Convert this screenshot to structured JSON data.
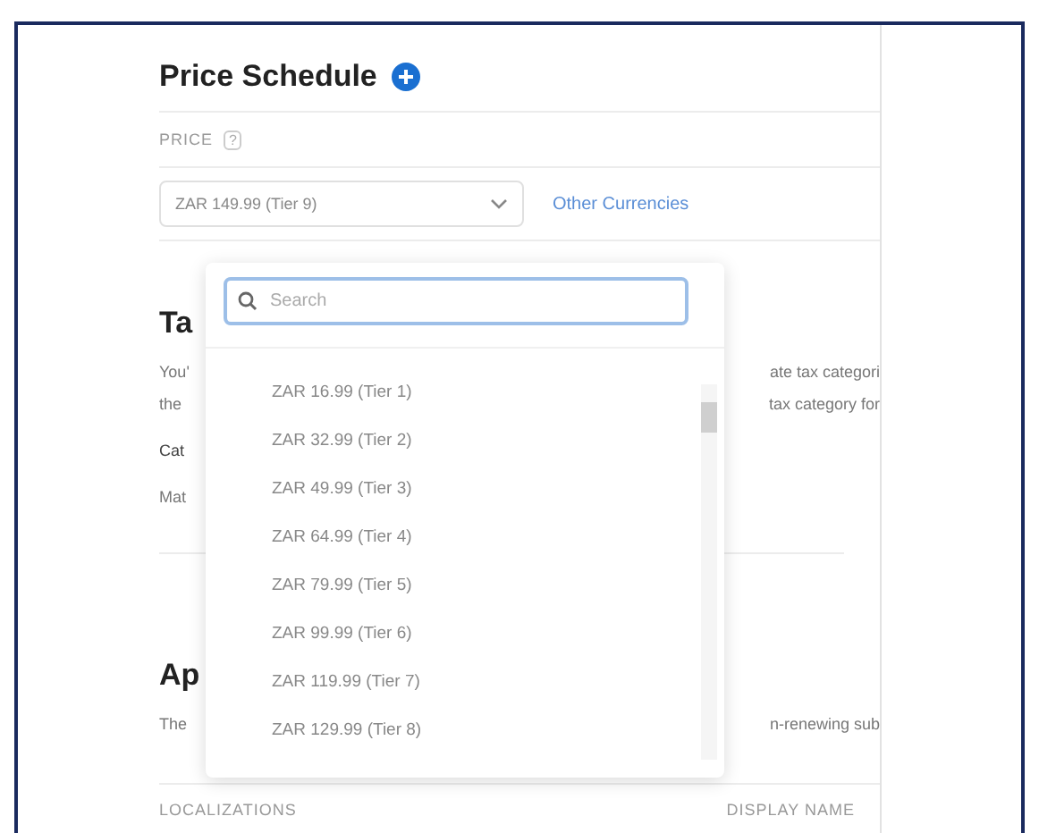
{
  "header": {
    "title": "Price Schedule"
  },
  "price": {
    "label": "PRICE",
    "help": "?",
    "value": "ZAR 149.99 (Tier 9)",
    "link": "Other Currencies"
  },
  "tax": {
    "heading": "Ta",
    "line_1_left": "You'",
    "line_1_right": "ate tax categori",
    "line_2_left": "the",
    "line_2_right": "tax category for",
    "field_label": "Cat",
    "field_value": "Mat"
  },
  "availability": {
    "heading": "Ap",
    "line_left": "The",
    "line_right": "n-renewing sub"
  },
  "table": {
    "columns": [
      "LOCALIZATIONS",
      "DISPLAY NAME"
    ]
  },
  "dropdown": {
    "search": {
      "placeholder": "Search"
    },
    "options": [
      {
        "label": "ZAR 16.99 (Tier 1)"
      },
      {
        "label": "ZAR 32.99 (Tier 2)"
      },
      {
        "label": "ZAR 49.99 (Tier 3)"
      },
      {
        "label": "ZAR 64.99 (Tier 4)"
      },
      {
        "label": "ZAR 79.99 (Tier 5)"
      },
      {
        "label": "ZAR 99.99 (Tier 6)"
      },
      {
        "label": "ZAR 119.99 (Tier 7)"
      },
      {
        "label": "ZAR 129.99 (Tier 8)"
      }
    ]
  }
}
